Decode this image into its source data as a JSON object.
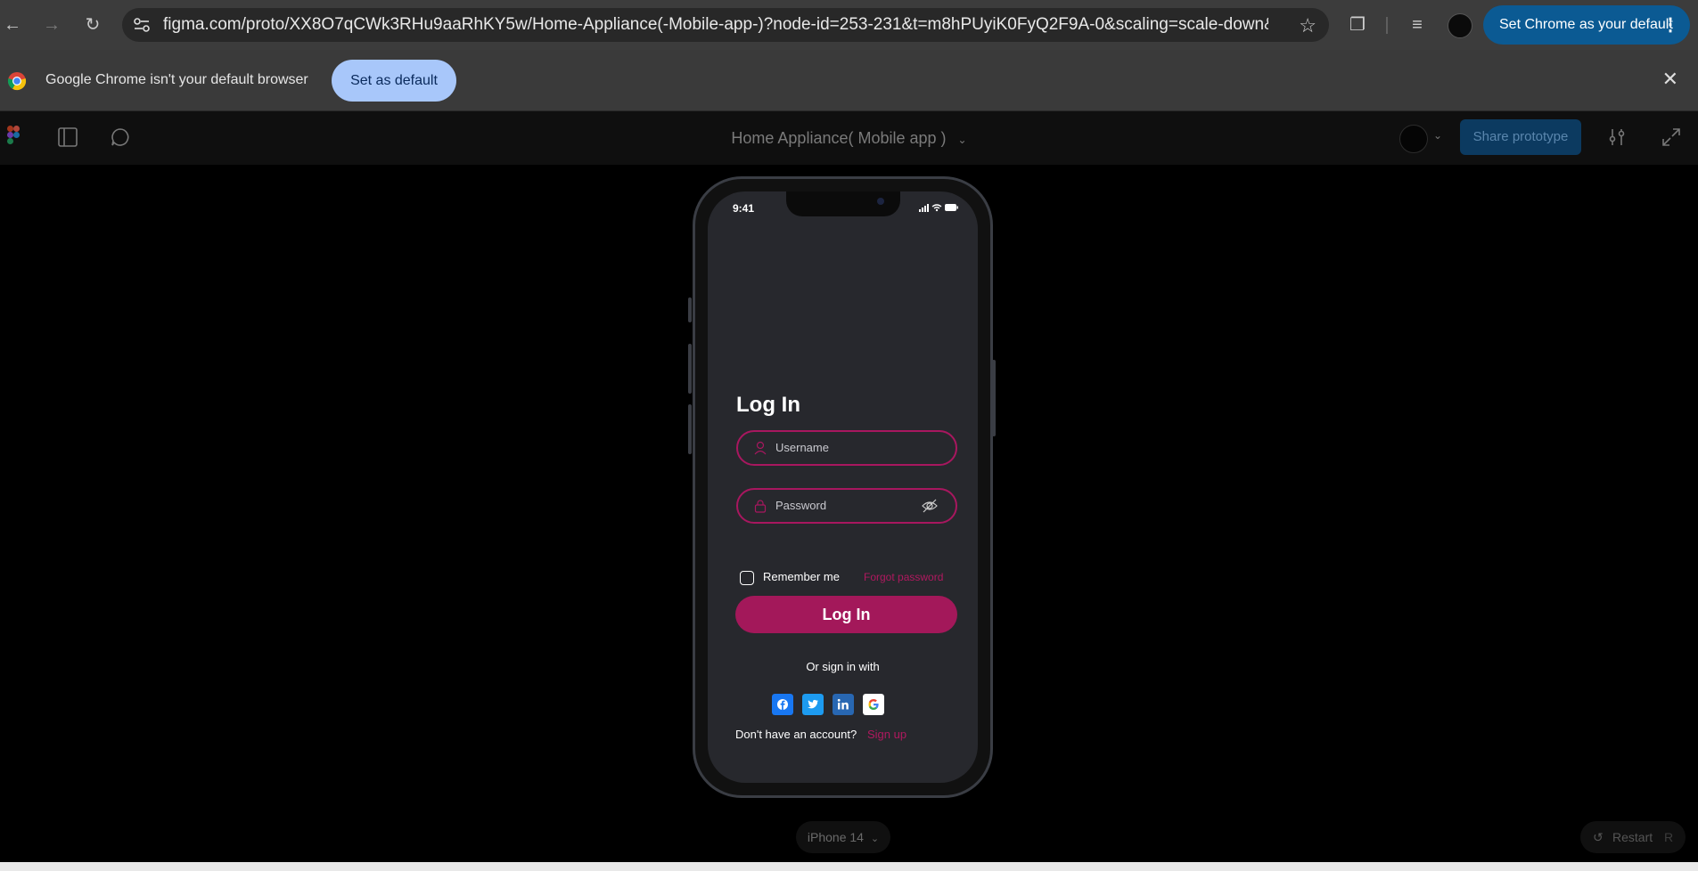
{
  "browser": {
    "url": "figma.com/proto/XX8O7qCWk3RHu9aaRhKY5w/Home-Appliance(-Mobile-app-)?node-id=253-231&t=m8hPUyiK0FyQ2F9A-0&scaling=scale-down&content-sc...",
    "set_default_pill": "Set Chrome as your default"
  },
  "infobar": {
    "message": "Google Chrome isn't your default browser",
    "set_default_button": "Set as default"
  },
  "figma": {
    "project_title": "Home Appliance( Mobile app )",
    "share_button": "Share prototype",
    "device_label": "iPhone 14",
    "restart_label": "Restart",
    "restart_key": "R"
  },
  "phone": {
    "status_time": "9:41",
    "title": "Log In",
    "username_placeholder": "Username",
    "password_placeholder": "Password",
    "remember_me": "Remember me",
    "forgot_password": "Forgot password",
    "login_button": "Log In",
    "or_sign_in_with": "Or sign in with",
    "no_account": "Don't have an account?",
    "sign_up": "Sign up"
  },
  "colors": {
    "accent": "#a3185a",
    "chrome_bar": "#3c3c3c",
    "phone_bg": "#27282d",
    "facebook": "#1877f2",
    "twitter": "#1d9bf0",
    "linkedin": "#2867b2"
  }
}
